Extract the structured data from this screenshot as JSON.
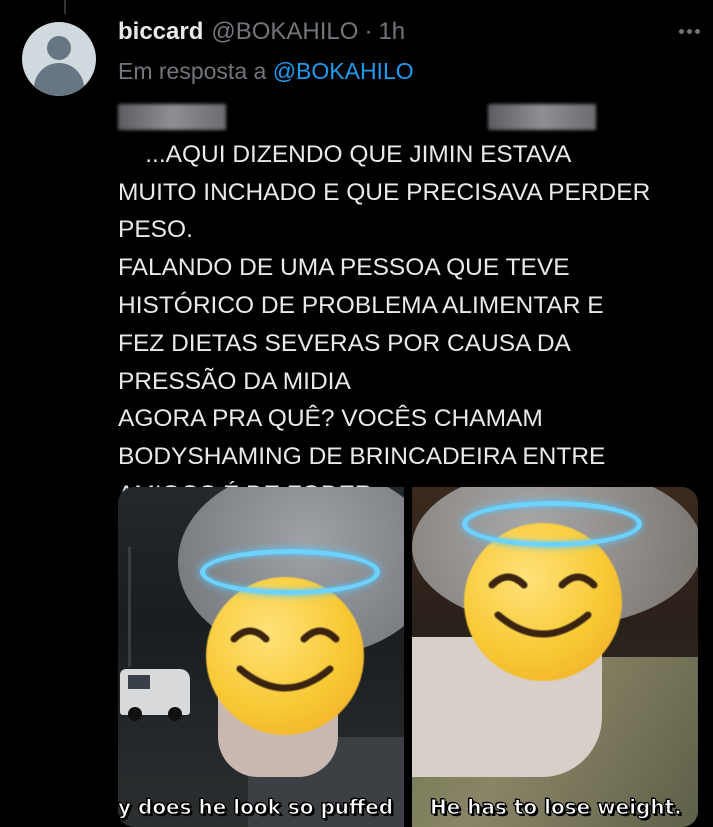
{
  "tweet": {
    "name": "biccard",
    "handle": "@BOKAHILO",
    "separator": "·",
    "time": "1h",
    "reply_prefix": "Em resposta a",
    "reply_to": "@BOKAHILO",
    "text": "...AQUI DIZENDO QUE JIMIN ESTAVA\nMUITO INCHADO E QUE PRECISAVA PERDER\nPESO.\nFALANDO DE UMA PESSOA QUE TEVE\nHISTÓRICO DE PROBLEMA ALIMENTAR E\nFEZ DIETAS SEVERAS POR CAUSA DA\nPRESSÃO DA MIDIA\nAGORA PRA QUÊ? VOCÊS CHAMAM\nBODYSHAMING DE BRINCADEIRA ENTRE\nAMIGOS É DE FODER"
  },
  "media": {
    "left_caption": "y does he look so puffed",
    "right_caption": "He has to lose weight."
  },
  "icons": {
    "avatar": "default-avatar-icon",
    "more": "more-options-icon",
    "emoji": "smiling-face-with-halo-emoji"
  },
  "colors": {
    "background": "#000000",
    "text": "#e7e9ea",
    "secondary": "#71767b",
    "link": "#1d9bf0"
  }
}
